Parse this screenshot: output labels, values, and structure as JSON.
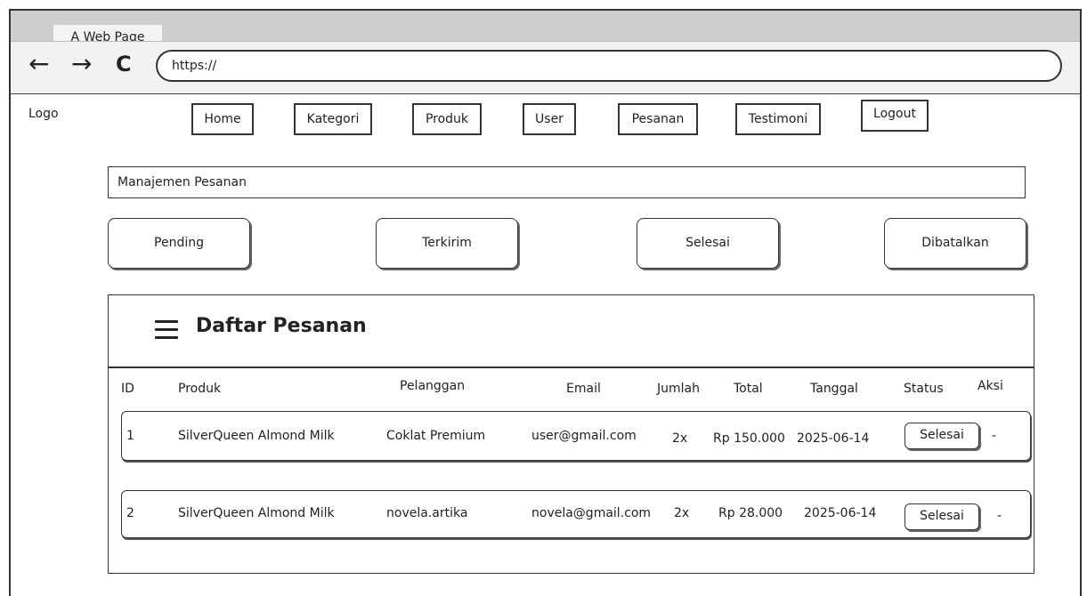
{
  "browser": {
    "tab_title": "A Web Page",
    "url": "https://",
    "back_icon": "←",
    "forward_icon": "→",
    "reload_icon": "C"
  },
  "header": {
    "logo": "Logo",
    "nav": [
      "Home",
      "Kategori",
      "Produk",
      "User",
      "Pesanan",
      "Testimoni",
      "Logout"
    ]
  },
  "section_title": "Manajemen Pesanan",
  "filters": [
    "Pending",
    "Terkirim",
    "Selesai",
    "Dibatalkan"
  ],
  "panel": {
    "title": "Daftar Pesanan",
    "columns": [
      "ID",
      "Produk",
      "Pelanggan",
      "Email",
      "Jumlah",
      "Total",
      "Tanggal",
      "Status",
      "Aksi"
    ],
    "rows": [
      {
        "id": "1",
        "produk": "SilverQueen Almond Milk",
        "pelanggan": "Coklat Premium",
        "email": "user@gmail.com",
        "jumlah": "2x",
        "total": "Rp 150.000",
        "tanggal": "2025-06-14",
        "status": "Selesai",
        "aksi": "-"
      },
      {
        "id": "2",
        "produk": "SilverQueen Almond Milk",
        "pelanggan": "novela.artika",
        "email": "novela@gmail.com",
        "jumlah": "2x",
        "total": "Rp 28.000",
        "tanggal": "2025-06-14",
        "status": "Selesai",
        "aksi": "-"
      }
    ]
  }
}
